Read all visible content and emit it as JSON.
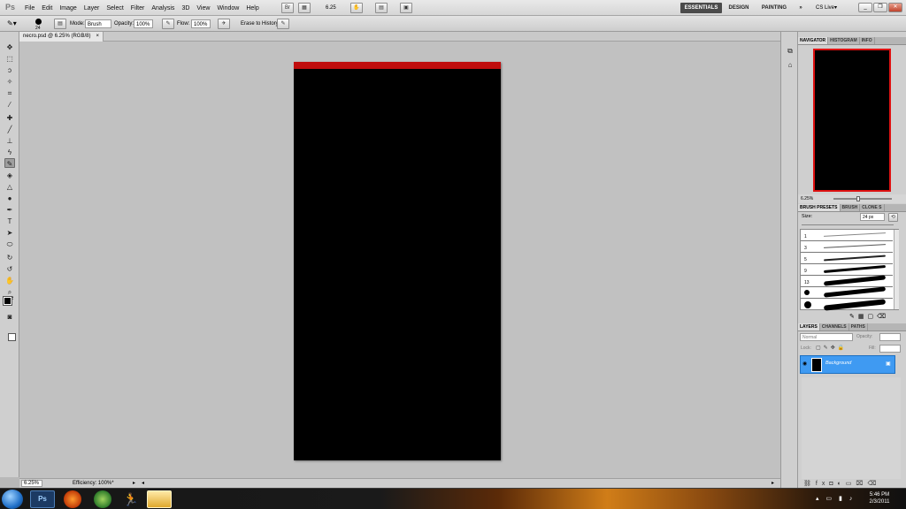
{
  "app": {
    "logo": "Ps"
  },
  "menus": [
    "File",
    "Edit",
    "Image",
    "Layer",
    "Select",
    "Filter",
    "Analysis",
    "3D",
    "View",
    "Window",
    "Help"
  ],
  "topbar": {
    "zoom": "6.25",
    "workspaces": [
      "ESSENTIALS",
      "DESIGN",
      "PAINTING"
    ],
    "more": "»",
    "cs_live": "CS Live▾",
    "active_workspace": "ESSENTIALS"
  },
  "options": {
    "brush_size": "24",
    "mode_label": "Mode:",
    "mode_value": "Brush",
    "opacity_label": "Opacity:",
    "opacity_value": "100%",
    "flow_label": "Flow:",
    "flow_value": "100%",
    "erase_history": "Erase to History"
  },
  "document": {
    "tab_title": "necro.psd @ 6.25% (RGB/8)",
    "close": "×",
    "band_color": "#c00c0c"
  },
  "status": {
    "zoom": "6.25%",
    "efficiency": "Efficiency: 100%*"
  },
  "panels": {
    "navigator_tabs": [
      "NAVIGATOR",
      "HISTOGRAM",
      "INFO"
    ],
    "navigator_zoom": "6.25%",
    "brush_tabs": [
      "BRUSH PRESETS",
      "BRUSH",
      "CLONE S"
    ],
    "size_label": "Size:",
    "size_value": "24 px",
    "brush_sizes": [
      "1",
      "3",
      "5",
      "9",
      "13"
    ],
    "layers_tabs": [
      "LAYERS",
      "CHANNELS",
      "PATHS"
    ],
    "blend_mode": "Normal",
    "opacity_label": "Opacity:",
    "lock_label": "Lock:",
    "fill_label": "Fill:",
    "layer_name": "Background"
  },
  "taskbar": {
    "time": "5:46 PM",
    "date": "2/3/2011"
  },
  "colors": {
    "selection_blue": "#3f9af2",
    "accent_red": "#d11111"
  }
}
